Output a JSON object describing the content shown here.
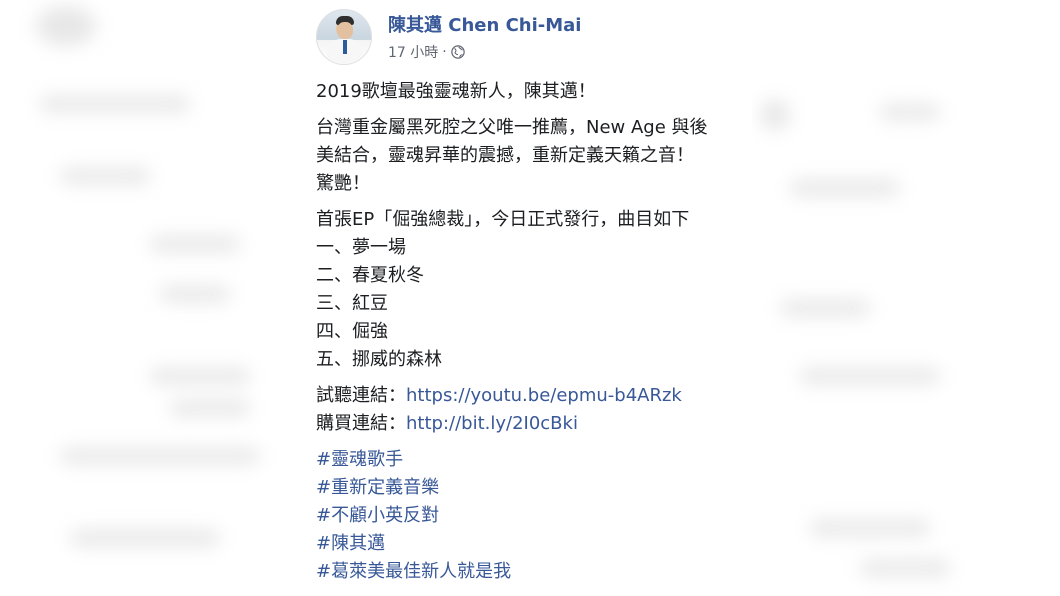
{
  "post": {
    "author": "陳其邁 Chen Chi-Mai",
    "time": "17 小時",
    "separator": "·",
    "privacy_icon": "globe-icon",
    "lines": {
      "headline": "2019歌壇最強靈魂新人，陳其邁！",
      "desc1": "台灣重金屬黑死腔之父唯一推薦，New Age 與後",
      "desc2": "美結合，靈魂昇華的震撼，重新定義天籟之音！",
      "desc3": "驚艷！",
      "ep_intro": "首張EP「倔強總裁」，今日正式發行，曲目如下",
      "tracks": [
        "一、夢一場",
        "二、春夏秋冬",
        "三、紅豆",
        "四、倔強",
        "五、挪威的森林"
      ],
      "listen_label": "試聽連結：",
      "listen_url": "https://youtu.be/epmu-b4ARzk",
      "buy_label": "購買連結：",
      "buy_url": "http://bit.ly/2I0cBki"
    },
    "hashtags": [
      "#靈魂歌手",
      "#重新定義音樂",
      "#不顧小英反對",
      "#陳其邁",
      "#葛萊美最佳新人就是我"
    ]
  },
  "colors": {
    "link": "#385898",
    "text": "#1c1e21",
    "meta": "#606770"
  }
}
